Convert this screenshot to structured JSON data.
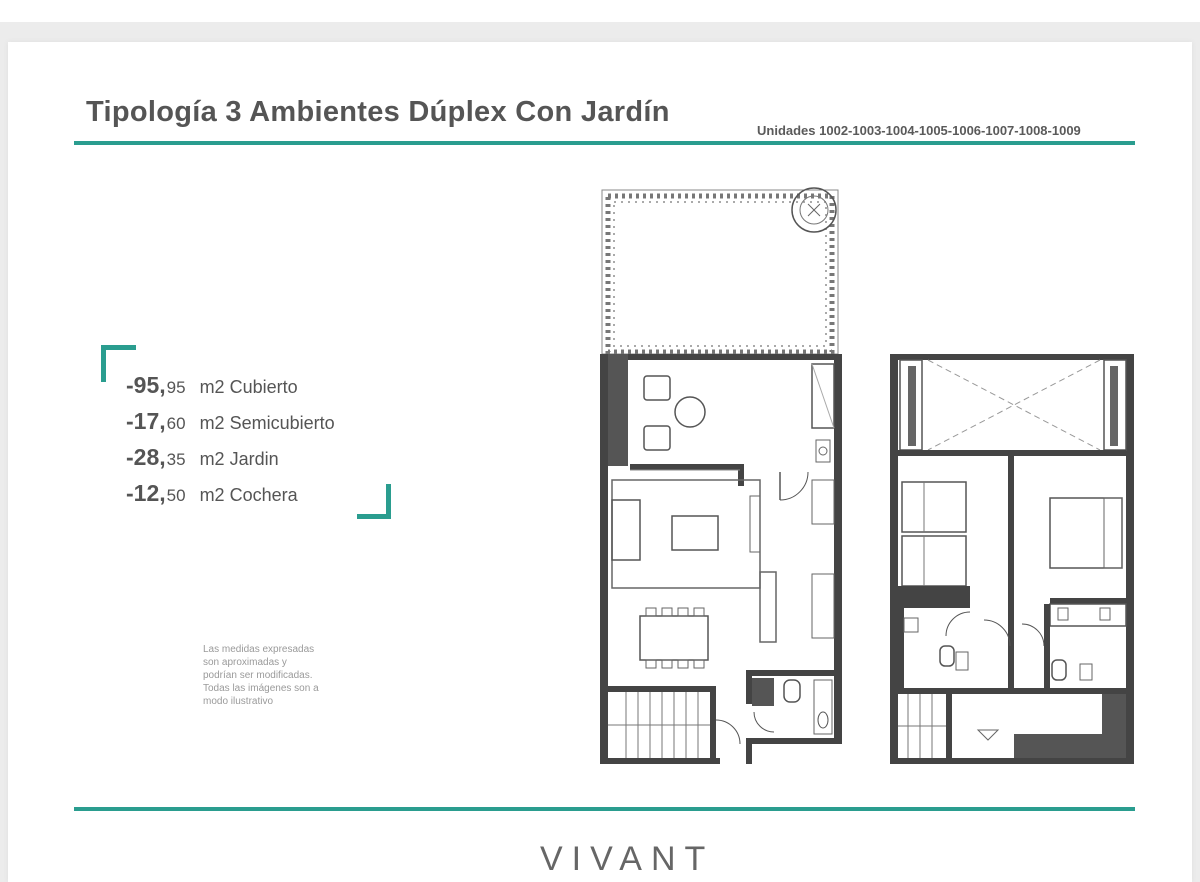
{
  "document": {
    "title": "Tipología 3 Ambientes Dúplex Con Jardín",
    "units": "Unidades 1002-1003-1004-1005-1006-1007-1008-1009",
    "brand": "VIVANT",
    "accent_color": "#2a9d8f"
  },
  "areas": [
    {
      "big": "-95,",
      "small": "95",
      "label": "m2 Cubierto"
    },
    {
      "big": "-17,",
      "small": "60",
      "label": "m2 Semicubierto"
    },
    {
      "big": "-28,",
      "small": "35",
      "label": "m2 Jardin"
    },
    {
      "big": "-12,",
      "small": "50",
      "label": "m2 Cochera"
    }
  ],
  "disclaimer": [
    "Las medidas expresadas",
    "son aproximadas y",
    "podrían ser modificadas.",
    "Todas las imágenes son a",
    "modo ilustrativo"
  ]
}
